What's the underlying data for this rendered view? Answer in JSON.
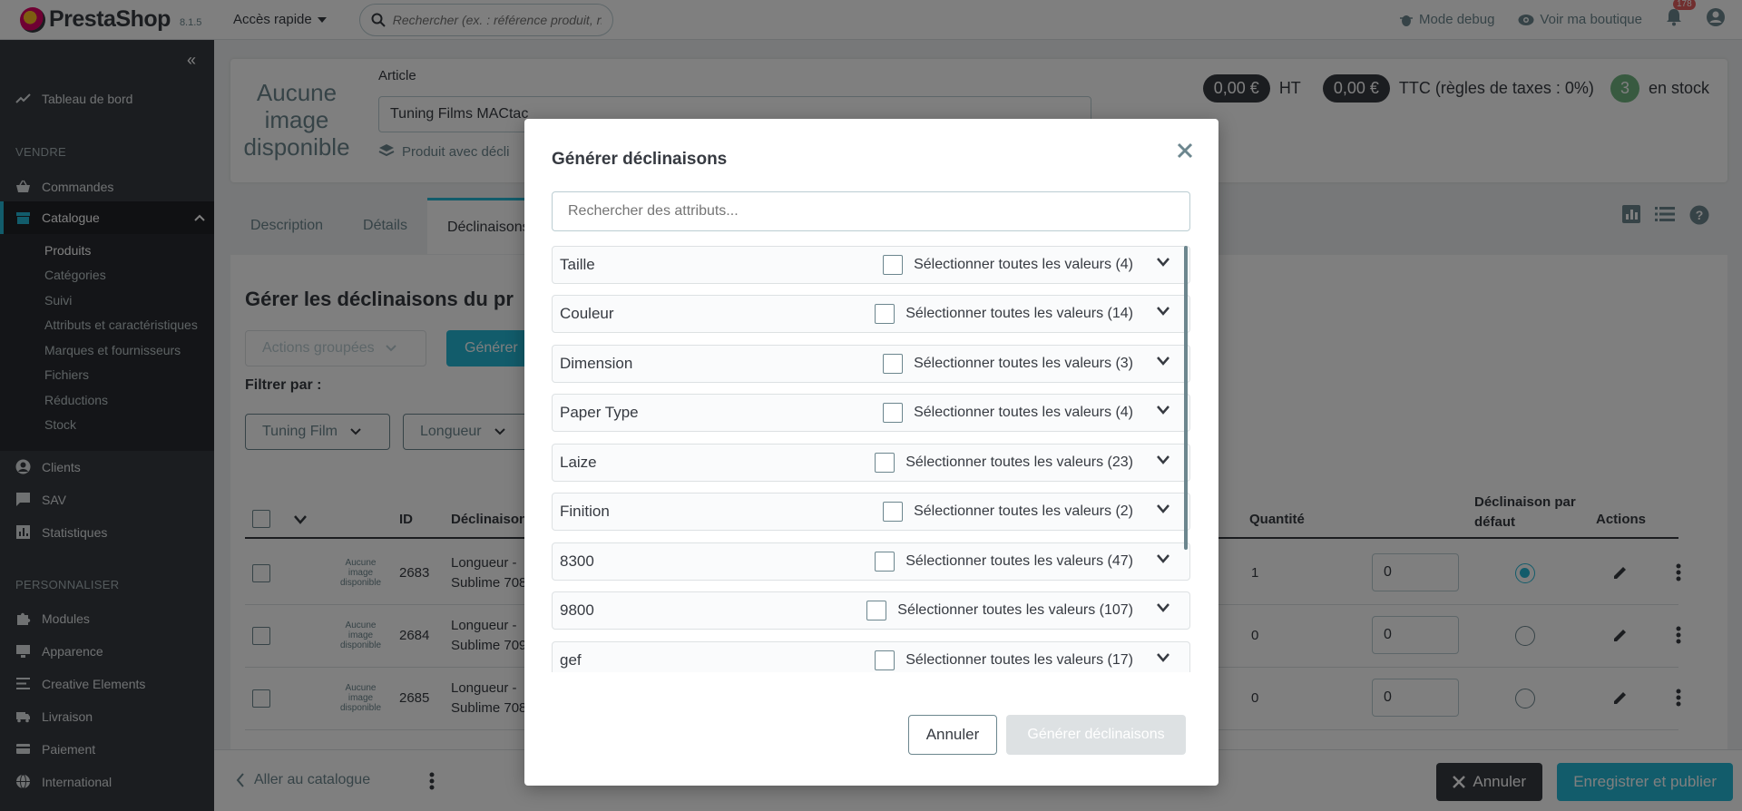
{
  "topbar": {
    "brand": "PrestaShop",
    "version": "8.1.5",
    "quick_access": "Accès rapide",
    "search_placeholder": "Rechercher (ex. : référence produit, no.",
    "debug_label": "Mode debug",
    "shop_label": "Voir ma boutique",
    "notifications_count": "178"
  },
  "sidebar": {
    "dashboard": "Tableau de bord",
    "section_sell": "VENDRE",
    "orders": "Commandes",
    "catalog": "Catalogue",
    "catalog_items": [
      "Produits",
      "Catégories",
      "Suivi",
      "Attributs et caractéristiques",
      "Marques et fournisseurs",
      "Fichiers",
      "Réductions",
      "Stock"
    ],
    "clients": "Clients",
    "sav": "SAV",
    "stats": "Statistiques",
    "section_custom": "PERSONNALISER",
    "modules": "Modules",
    "appearance": "Apparence",
    "creative": "Creative Elements",
    "shipping": "Livraison",
    "payment": "Paiement",
    "international": "International"
  },
  "product": {
    "no_image": "Aucune image disponible",
    "article_label": "Article",
    "article_name": "Tuning Films MACtac",
    "product_type": "Produit avec décli",
    "price_ht": "0,00 €",
    "ht": "HT",
    "price_ttc": "0,00 €",
    "ttc": "TTC (règles de taxes : 0%)",
    "stock": "3",
    "stock_label": "en stock"
  },
  "tabs": [
    "Description",
    "Détails",
    "Déclinaisons"
  ],
  "content": {
    "title": "Gérer les déclinaisons du pr",
    "bulk_actions": "Actions groupées",
    "generate": "Générer",
    "filter_by": "Filtrer par :",
    "filters": [
      "Tuning Film",
      "Longueur"
    ]
  },
  "table": {
    "headers": {
      "id": "ID",
      "combination": "Déclinaison",
      "quantity": "Quantité",
      "default": "Déclinaison par défaut",
      "actions": "Actions"
    },
    "rows": [
      {
        "noimg": "Aucune image disponible",
        "id": "2683",
        "name": "Longueur -",
        "name2": "Sublime 708",
        "qty": "1",
        "stock": "0",
        "default": true
      },
      {
        "noimg": "Aucune image disponible",
        "id": "2684",
        "name": "Longueur -",
        "name2": "Sublime 709",
        "qty": "0",
        "stock": "0",
        "default": false
      },
      {
        "noimg": "Aucune image disponible",
        "id": "2685",
        "name": "Longueur -",
        "name2": "Sublime 708",
        "qty": "0",
        "stock": "0",
        "default": false
      }
    ]
  },
  "footer": {
    "back": "Aller au catalogue",
    "cancel": "Annuler",
    "save": "Enregistrer et publier"
  },
  "modal": {
    "title": "Générer déclinaisons",
    "search_placeholder": "Rechercher des attributs...",
    "attributes": [
      {
        "name": "Taille",
        "select_label": "Sélectionner toutes les valeurs (4)"
      },
      {
        "name": "Couleur",
        "select_label": "Sélectionner toutes les valeurs (14)"
      },
      {
        "name": "Dimension",
        "select_label": "Sélectionner toutes les valeurs (3)"
      },
      {
        "name": "Paper Type",
        "select_label": "Sélectionner toutes les valeurs (4)"
      },
      {
        "name": "Laize",
        "select_label": "Sélectionner toutes les valeurs (23)"
      },
      {
        "name": "Finition",
        "select_label": "Sélectionner toutes les valeurs (2)"
      },
      {
        "name": "8300",
        "select_label": "Sélectionner toutes les valeurs (47)"
      },
      {
        "name": "9800",
        "select_label": "Sélectionner toutes les valeurs (107)"
      },
      {
        "name": "gef",
        "select_label": "Sélectionner toutes les valeurs (17)"
      }
    ],
    "cancel": "Annuler",
    "generate": "Générer déclinaisons"
  },
  "colors": {
    "accent": "#25b9d7",
    "dark": "#363a41",
    "green": "#70b580",
    "notif": "#e35f5f"
  }
}
